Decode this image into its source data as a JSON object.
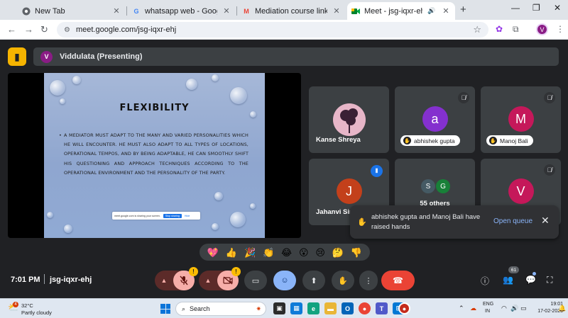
{
  "browser": {
    "tabs": [
      {
        "title": "New Tab",
        "favicon": "chrome-icon",
        "active": false
      },
      {
        "title": "whatsapp web - Google Search",
        "favicon": "G",
        "active": false
      },
      {
        "title": "Mediation course link - mohod",
        "favicon": "M",
        "active": false
      },
      {
        "title": "Meet - jsg-iqxr-ehj",
        "favicon": "meet-icon",
        "active": true
      }
    ],
    "new_tab_label": "+",
    "url": "meet.google.com/jsg-iqxr-ehj",
    "profile_initial": "V"
  },
  "meet": {
    "presenter": {
      "initial": "V",
      "label": "Viddulata (Presenting)"
    },
    "slide": {
      "title": "FLEXIBILITY",
      "body": "A MEDIATOR MUST ADAPT TO THE MANY AND VARIED PERSONALITIES WHICH HE WILL ENCOUNTER. HE MUST ALSO ADAPT TO ALL TYPES OF LOCATIONS, OPERATIONAL TEMPOS, AND BY BEING ADAPTABLE, HE CAN SMOOTHLY SHIFT HIS QUESTIONING AND APPROACH TECHNIQUES ACCORDING TO THE OPERATIONAL ENVIRONMENT AND THE PERSONALITY OF THE PARTY.",
      "share_banner": {
        "text": "meet.google.com is sharing your screen.",
        "stop_label": "Stop sharing",
        "hide_label": "Hide"
      }
    },
    "participants": [
      {
        "name": "Kanse Shreya",
        "initial": "",
        "color": "#6b4a63",
        "muted": false,
        "hand": false
      },
      {
        "name": "abhishek gupta",
        "initial": "a",
        "color": "#8430ce",
        "muted": true,
        "hand": true
      },
      {
        "name": "Manoj Bali",
        "initial": "M",
        "color": "#c5185a",
        "muted": true,
        "hand": true
      },
      {
        "name": "Jahanvi Sin",
        "initial": "J",
        "color": "#c3401b",
        "muted": false,
        "hand": false,
        "speaking": true
      },
      {
        "name": "55 others",
        "initials": [
          "S",
          "G"
        ],
        "colors": [
          "#455a64",
          "#188038"
        ]
      },
      {
        "name": "",
        "initial": "V",
        "color": "#c5185a",
        "muted": true
      }
    ],
    "notification": {
      "text": "abhishek gupta and Manoj Bali have raised hands",
      "action_label": "Open queue"
    },
    "reactions": [
      "💖",
      "👍",
      "🎉",
      "👏",
      "😂",
      "😮",
      "😢",
      "🤔",
      "👎"
    ],
    "bottom": {
      "time": "7:01 PM",
      "meeting_code": "jsg-iqxr-ehj",
      "participant_count": "61"
    },
    "colors": {
      "accent": "#8ab4f8",
      "end_call": "#ea4335",
      "muted_fill": "#f6aea9"
    }
  },
  "taskbar": {
    "weather_badge": "4",
    "temperature": "32°C",
    "weather": "Partly cloudy",
    "search_placeholder": "Search",
    "lang_line1": "ENG",
    "lang_line2": "IN",
    "time": "19:01",
    "date": "17-02-2025"
  }
}
